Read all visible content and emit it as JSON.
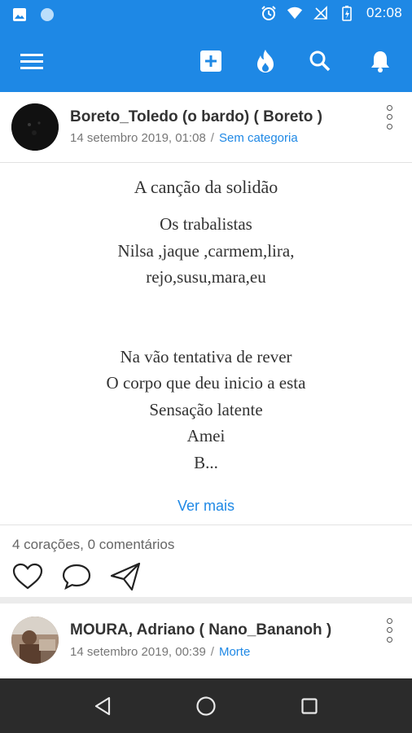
{
  "status_bar": {
    "time": "02:08",
    "left_icons": [
      "image-icon",
      "circle-icon"
    ],
    "right_icons": [
      "alarm-icon",
      "wifi-icon",
      "no-signal-icon",
      "battery-charging-icon"
    ]
  },
  "app_bar": {
    "icons": [
      "menu-icon",
      "add-post-icon",
      "trending-flame-icon",
      "search-icon",
      "notifications-bell-icon"
    ],
    "color": "#1e88e5"
  },
  "posts": [
    {
      "author": "Boreto_Toledo (o bardo) ( Boreto )",
      "date": "14 setembro 2019, 01:08",
      "separator": "/",
      "category": "Sem categoria",
      "title": "A canção da solidão",
      "lines": [
        "Os trabalistas",
        "Nilsa ,jaque ,carmem,lira,",
        "rejo,susu,mara,eu",
        "",
        "",
        "Na vão tentativa de rever",
        "O corpo que deu inicio a esta",
        "Sensação  latente",
        "Amei",
        "B..."
      ],
      "see_more": "Ver mais",
      "stats": "4 corações, 0 comentários",
      "actions": [
        "heart-icon",
        "comment-icon",
        "share-send-icon"
      ]
    },
    {
      "author": "MOURA, Adriano ( Nano_Bananoh )",
      "date": "14 setembro 2019, 00:39",
      "separator": "/",
      "category": "Morte"
    }
  ],
  "nav_bar": {
    "icons": [
      "back-triangle-icon",
      "home-circle-icon",
      "recents-square-icon"
    ]
  }
}
